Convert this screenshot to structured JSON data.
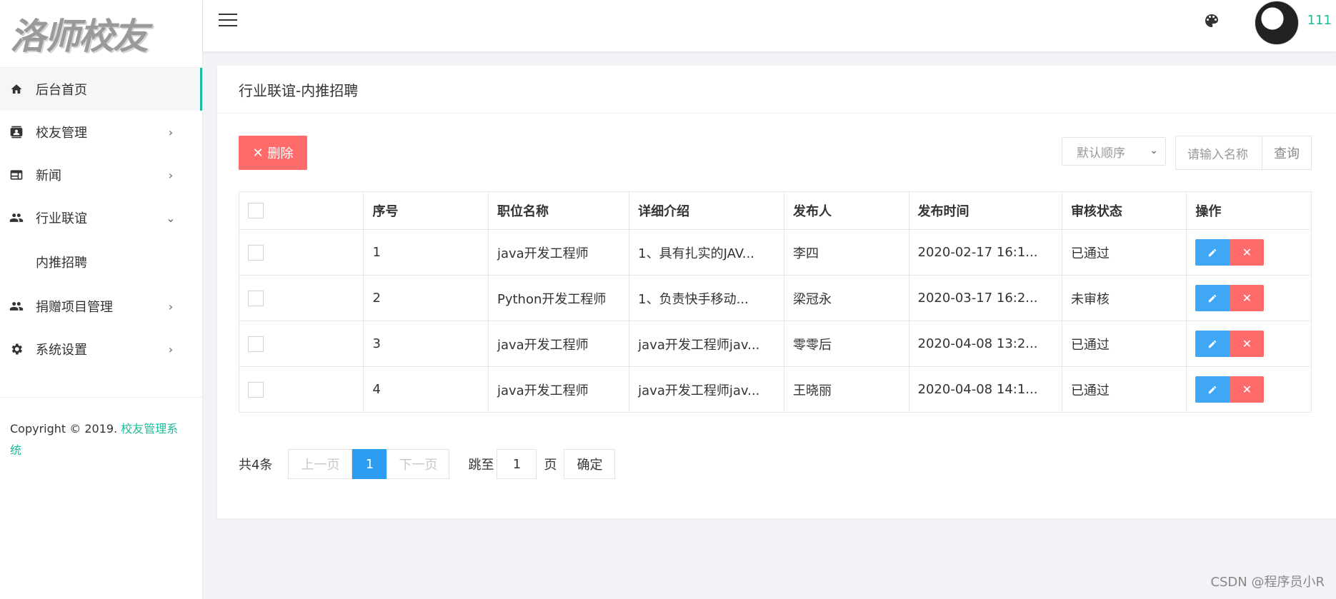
{
  "logo": {
    "text": "洛师校友"
  },
  "sidebar": {
    "items": [
      {
        "label": "后台首页",
        "icon": "home-icon"
      },
      {
        "label": "校友管理",
        "icon": "contact-card-icon"
      },
      {
        "label": "新闻",
        "icon": "news-icon"
      },
      {
        "label": "行业联谊",
        "icon": "people-icon"
      },
      {
        "label": "捐赠项目管理",
        "icon": "people-icon"
      },
      {
        "label": "系统设置",
        "icon": "gear-icon"
      }
    ],
    "sub_item": "内推招聘",
    "copyright_prefix": "Copyright © 2019. ",
    "copyright_link": "校友管理系统"
  },
  "header": {
    "username": "111"
  },
  "page": {
    "title": "行业联谊-内推招聘"
  },
  "toolbar": {
    "delete_label": "删除",
    "sort_value": "默认顺序",
    "search_placeholder": "请输入名称",
    "search_label": "查询"
  },
  "table": {
    "headers": [
      "序号",
      "职位名称",
      "详细介绍",
      "发布人",
      "发布时间",
      "审核状态",
      "操作"
    ],
    "rows": [
      {
        "no": "1",
        "title": "java开发工程师",
        "detail": "1、具有扎实的JAV...",
        "publisher": "李四",
        "time": "2020-02-17 16:1...",
        "status": "已通过"
      },
      {
        "no": "2",
        "title": "Python开发工程师",
        "detail": "1、负责快手移动...",
        "publisher": "梁冠永",
        "time": "2020-03-17 16:2...",
        "status": "未审核"
      },
      {
        "no": "3",
        "title": "java开发工程师",
        "detail": "java开发工程师jav...",
        "publisher": "零零后",
        "time": "2020-04-08 13:2...",
        "status": "已通过"
      },
      {
        "no": "4",
        "title": "java开发工程师",
        "detail": "java开发工程师jav...",
        "publisher": "王晓丽",
        "time": "2020-04-08 14:1...",
        "status": "已通过"
      }
    ]
  },
  "pager": {
    "total": "共4条",
    "prev": "上一页",
    "current": "1",
    "next": "下一页",
    "jump_label": "跳至",
    "jump_value": "1",
    "unit": "页",
    "confirm": "确定"
  },
  "watermark": "CSDN @程序员小R",
  "colors": {
    "accent": "#1bbc9b",
    "danger": "#ff6b6b",
    "primary": "#2b9cf0"
  }
}
